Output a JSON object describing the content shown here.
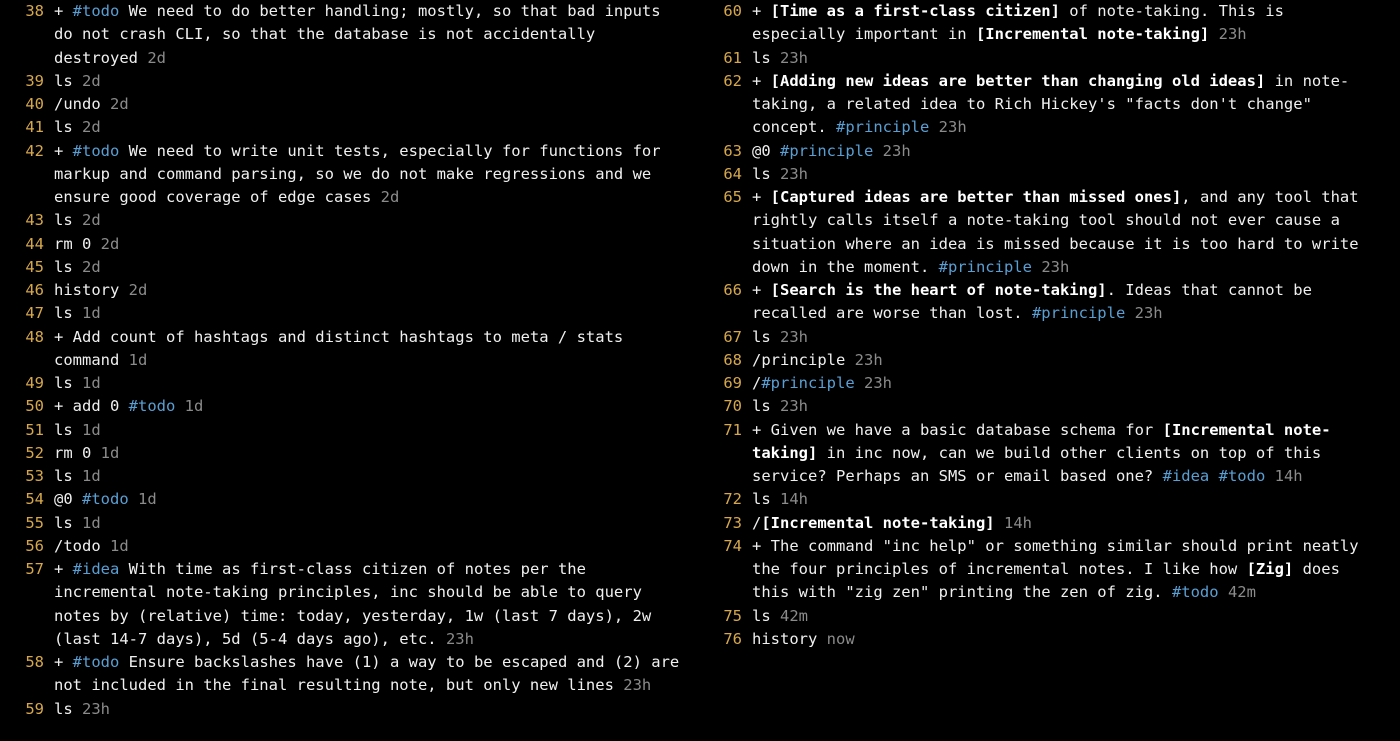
{
  "colors": {
    "line_number": "#d6a84b",
    "tag": "#5a9fd4",
    "timestamp": "#8b8b8b",
    "text": "#f0f0f0",
    "bold": "#ffffff",
    "background": "#000000"
  },
  "entries": [
    {
      "n": 38,
      "segs": [
        {
          "t": "plain",
          "v": "+ "
        },
        {
          "t": "tag",
          "v": "#todo"
        },
        {
          "t": "plain",
          "v": " We need to do better handling; mostly, so that bad inputs do not crash CLI, so that the database is not accidentally destroyed "
        },
        {
          "t": "time",
          "v": "2d"
        }
      ]
    },
    {
      "n": 39,
      "segs": [
        {
          "t": "plain",
          "v": "ls "
        },
        {
          "t": "time",
          "v": "2d"
        }
      ]
    },
    {
      "n": 40,
      "segs": [
        {
          "t": "plain",
          "v": "/undo "
        },
        {
          "t": "time",
          "v": "2d"
        }
      ]
    },
    {
      "n": 41,
      "segs": [
        {
          "t": "plain",
          "v": "ls "
        },
        {
          "t": "time",
          "v": "2d"
        }
      ]
    },
    {
      "n": 42,
      "segs": [
        {
          "t": "plain",
          "v": "+ "
        },
        {
          "t": "tag",
          "v": "#todo"
        },
        {
          "t": "plain",
          "v": " We need to write unit tests, especially for functions for markup and command parsing, so we do not make regressions and we ensure good coverage of edge cases "
        },
        {
          "t": "time",
          "v": "2d"
        }
      ]
    },
    {
      "n": 43,
      "segs": [
        {
          "t": "plain",
          "v": "ls "
        },
        {
          "t": "time",
          "v": "2d"
        }
      ]
    },
    {
      "n": 44,
      "segs": [
        {
          "t": "plain",
          "v": "rm 0 "
        },
        {
          "t": "time",
          "v": "2d"
        }
      ]
    },
    {
      "n": 45,
      "segs": [
        {
          "t": "plain",
          "v": "ls "
        },
        {
          "t": "time",
          "v": "2d"
        }
      ]
    },
    {
      "n": 46,
      "segs": [
        {
          "t": "plain",
          "v": "history "
        },
        {
          "t": "time",
          "v": "2d"
        }
      ]
    },
    {
      "n": 47,
      "segs": [
        {
          "t": "plain",
          "v": "ls "
        },
        {
          "t": "time",
          "v": "1d"
        }
      ]
    },
    {
      "n": 48,
      "segs": [
        {
          "t": "plain",
          "v": "+ Add count of hashtags and distinct hashtags to meta / stats command "
        },
        {
          "t": "time",
          "v": "1d"
        }
      ]
    },
    {
      "n": 49,
      "segs": [
        {
          "t": "plain",
          "v": "ls "
        },
        {
          "t": "time",
          "v": "1d"
        }
      ]
    },
    {
      "n": 50,
      "segs": [
        {
          "t": "plain",
          "v": "+ add 0 "
        },
        {
          "t": "tag",
          "v": "#todo"
        },
        {
          "t": "plain",
          "v": " "
        },
        {
          "t": "time",
          "v": "1d"
        }
      ]
    },
    {
      "n": 51,
      "segs": [
        {
          "t": "plain",
          "v": "ls "
        },
        {
          "t": "time",
          "v": "1d"
        }
      ]
    },
    {
      "n": 52,
      "segs": [
        {
          "t": "plain",
          "v": "rm 0 "
        },
        {
          "t": "time",
          "v": "1d"
        }
      ]
    },
    {
      "n": 53,
      "segs": [
        {
          "t": "plain",
          "v": "ls "
        },
        {
          "t": "time",
          "v": "1d"
        }
      ]
    },
    {
      "n": 54,
      "segs": [
        {
          "t": "plain",
          "v": "@0 "
        },
        {
          "t": "tag",
          "v": "#todo"
        },
        {
          "t": "plain",
          "v": " "
        },
        {
          "t": "time",
          "v": "1d"
        }
      ]
    },
    {
      "n": 55,
      "segs": [
        {
          "t": "plain",
          "v": "ls "
        },
        {
          "t": "time",
          "v": "1d"
        }
      ]
    },
    {
      "n": 56,
      "segs": [
        {
          "t": "plain",
          "v": "/todo "
        },
        {
          "t": "time",
          "v": "1d"
        }
      ]
    },
    {
      "n": 57,
      "segs": [
        {
          "t": "plain",
          "v": "+ "
        },
        {
          "t": "tag",
          "v": "#idea"
        },
        {
          "t": "plain",
          "v": " With time as first-class citizen of notes per the incremental note-taking principles, inc should be able to query notes by (relative) time: today, yesterday, 1w (last 7 days), 2w (last 14-7 days), 5d (5-4 days ago), etc. "
        },
        {
          "t": "time",
          "v": "23h"
        }
      ]
    },
    {
      "n": 58,
      "segs": [
        {
          "t": "plain",
          "v": "+ "
        },
        {
          "t": "tag",
          "v": "#todo"
        },
        {
          "t": "plain",
          "v": " Ensure backslashes have (1) a way to be escaped and (2) are not included in the final resulting note, but only new lines "
        },
        {
          "t": "time",
          "v": "23h"
        }
      ]
    },
    {
      "n": 59,
      "segs": [
        {
          "t": "plain",
          "v": "ls "
        },
        {
          "t": "time",
          "v": "23h"
        }
      ]
    },
    {
      "n": 60,
      "segs": [
        {
          "t": "plain",
          "v": "+ "
        },
        {
          "t": "bold",
          "v": "[Time as a first-class citizen]"
        },
        {
          "t": "plain",
          "v": " of note-taking. This is especially important in "
        },
        {
          "t": "bold",
          "v": "[Incremental note-taking]"
        },
        {
          "t": "plain",
          "v": " "
        },
        {
          "t": "time",
          "v": "23h"
        }
      ]
    },
    {
      "n": 61,
      "segs": [
        {
          "t": "plain",
          "v": "ls "
        },
        {
          "t": "time",
          "v": "23h"
        }
      ]
    },
    {
      "n": 62,
      "segs": [
        {
          "t": "plain",
          "v": "+ "
        },
        {
          "t": "bold",
          "v": "[Adding new ideas are better than changing old ideas]"
        },
        {
          "t": "plain",
          "v": " in note-taking, a related idea to Rich Hickey's \"facts don't change\" concept. "
        },
        {
          "t": "tag",
          "v": "#principle"
        },
        {
          "t": "plain",
          "v": " "
        },
        {
          "t": "time",
          "v": "23h"
        }
      ]
    },
    {
      "n": 63,
      "segs": [
        {
          "t": "plain",
          "v": "@0 "
        },
        {
          "t": "tag",
          "v": "#principle"
        },
        {
          "t": "plain",
          "v": " "
        },
        {
          "t": "time",
          "v": "23h"
        }
      ]
    },
    {
      "n": 64,
      "segs": [
        {
          "t": "plain",
          "v": "ls "
        },
        {
          "t": "time",
          "v": "23h"
        }
      ]
    },
    {
      "n": 65,
      "segs": [
        {
          "t": "plain",
          "v": "+ "
        },
        {
          "t": "bold",
          "v": "[Captured ideas are better than missed ones]"
        },
        {
          "t": "plain",
          "v": ", and any tool that rightly calls itself a note-taking tool should not ever cause a situation where an idea is missed because it is too hard to write down in the moment. "
        },
        {
          "t": "tag",
          "v": "#principle"
        },
        {
          "t": "plain",
          "v": " "
        },
        {
          "t": "time",
          "v": "23h"
        }
      ]
    },
    {
      "n": 66,
      "segs": [
        {
          "t": "plain",
          "v": "+ "
        },
        {
          "t": "bold",
          "v": "[Search is the heart of note-taking]"
        },
        {
          "t": "plain",
          "v": ". Ideas that cannot be recalled are worse than lost. "
        },
        {
          "t": "tag",
          "v": "#principle"
        },
        {
          "t": "plain",
          "v": " "
        },
        {
          "t": "time",
          "v": "23h"
        }
      ]
    },
    {
      "n": 67,
      "segs": [
        {
          "t": "plain",
          "v": "ls "
        },
        {
          "t": "time",
          "v": "23h"
        }
      ]
    },
    {
      "n": 68,
      "segs": [
        {
          "t": "plain",
          "v": "/principle "
        },
        {
          "t": "time",
          "v": "23h"
        }
      ]
    },
    {
      "n": 69,
      "segs": [
        {
          "t": "plain",
          "v": "/"
        },
        {
          "t": "tag",
          "v": "#principle"
        },
        {
          "t": "plain",
          "v": " "
        },
        {
          "t": "time",
          "v": "23h"
        }
      ]
    },
    {
      "n": 70,
      "segs": [
        {
          "t": "plain",
          "v": "ls "
        },
        {
          "t": "time",
          "v": "23h"
        }
      ]
    },
    {
      "n": 71,
      "segs": [
        {
          "t": "plain",
          "v": "+ Given we have a basic database schema for "
        },
        {
          "t": "bold",
          "v": "[Incremental note-taking]"
        },
        {
          "t": "plain",
          "v": " in inc now, can we build other clients on top of this service? Perhaps an SMS or email based one? "
        },
        {
          "t": "tag",
          "v": "#idea"
        },
        {
          "t": "plain",
          "v": " "
        },
        {
          "t": "tag",
          "v": "#todo"
        },
        {
          "t": "plain",
          "v": " "
        },
        {
          "t": "time",
          "v": "14h"
        }
      ]
    },
    {
      "n": 72,
      "segs": [
        {
          "t": "plain",
          "v": "ls "
        },
        {
          "t": "time",
          "v": "14h"
        }
      ]
    },
    {
      "n": 73,
      "segs": [
        {
          "t": "plain",
          "v": "/"
        },
        {
          "t": "bold",
          "v": "[Incremental note-taking]"
        },
        {
          "t": "plain",
          "v": " "
        },
        {
          "t": "time",
          "v": "14h"
        }
      ]
    },
    {
      "n": 74,
      "segs": [
        {
          "t": "plain",
          "v": "+ The command \"inc help\" or something similar should print neatly the four principles of incremental notes. I like how "
        },
        {
          "t": "bold",
          "v": "[Zig]"
        },
        {
          "t": "plain",
          "v": " does this with \"zig zen\" printing the zen of zig. "
        },
        {
          "t": "tag",
          "v": "#todo"
        },
        {
          "t": "plain",
          "v": " "
        },
        {
          "t": "time",
          "v": "42m"
        }
      ]
    },
    {
      "n": 75,
      "segs": [
        {
          "t": "plain",
          "v": "ls "
        },
        {
          "t": "time",
          "v": "42m"
        }
      ]
    },
    {
      "n": 76,
      "segs": [
        {
          "t": "plain",
          "v": "history "
        },
        {
          "t": "time",
          "v": "now"
        }
      ]
    }
  ]
}
